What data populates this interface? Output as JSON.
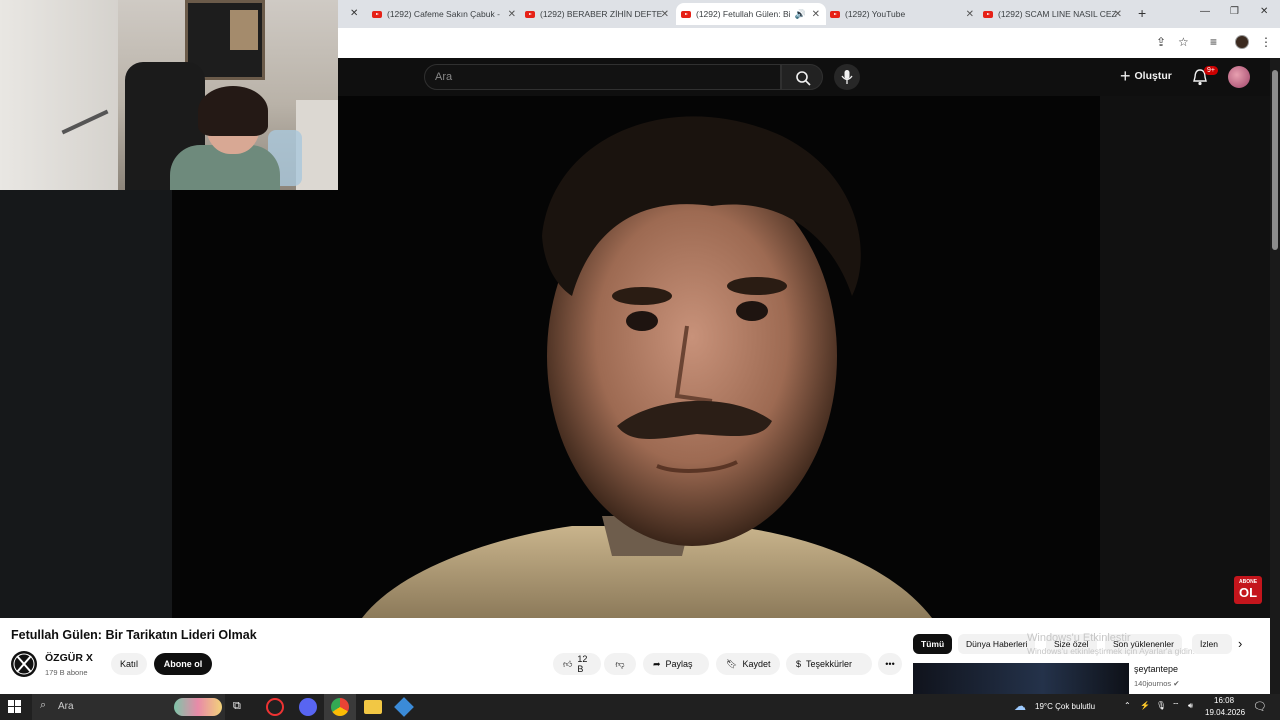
{
  "browser": {
    "tabs": [
      {
        "title": "(1292) Cafeme Sakın Çabuk -"
      },
      {
        "title": "(1292) BERABER ZİHİN DEFTE"
      },
      {
        "title": "(1292) Fetullah Gülen: Bi"
      },
      {
        "title": "(1292) YouTube"
      },
      {
        "title": "(1292) SCAM LINE NASIL CEZ"
      }
    ]
  },
  "youtube": {
    "search_placeholder": "Ara",
    "create_label": "Oluştur",
    "notifications_badge": "9+",
    "abone_badge_top": "ABONE",
    "abone_badge_bottom": "OL"
  },
  "video": {
    "title": "Fetullah Gülen: Bir Tarikatın Lideri Olmak",
    "channel_name": "ÖZGÜR X",
    "subscribers": "179 B abone",
    "join_label": "Katıl",
    "subscribe_label": "Abone ol",
    "like_count": "12 B",
    "share_label": "Paylaş",
    "save_label": "Kaydet",
    "thanks_label": "Teşekkürler"
  },
  "sidebar": {
    "chips": [
      "Tümü",
      "Dünya Haberleri",
      "Size özel",
      "Son yüklenenler",
      "İzlen"
    ],
    "recommendation": {
      "title": "şeytantepe",
      "channel": "140journos"
    },
    "watermark_line1": "Windows'u Etkinleştir",
    "watermark_line2": "Windows'u etkinleştirmek için Ayarlar'a gidin."
  },
  "taskbar": {
    "search_label": "Ara",
    "weather": "19°C  Çok bulutlu",
    "time": "16:08",
    "date": "19.04.2026"
  }
}
